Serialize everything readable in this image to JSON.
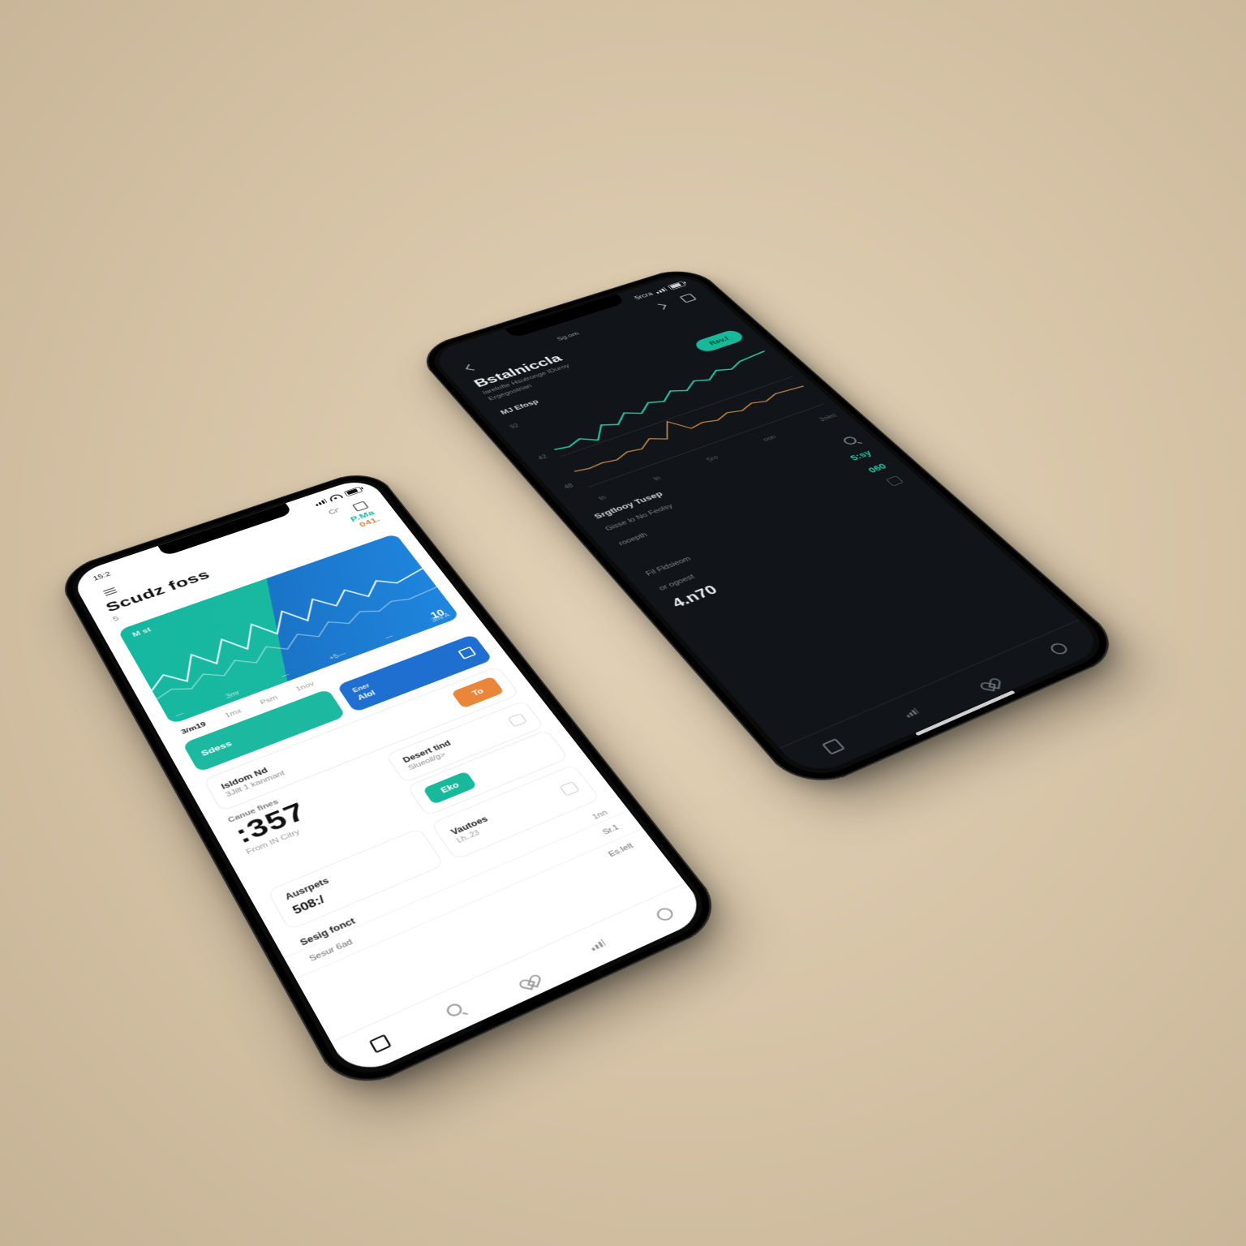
{
  "phone_light": {
    "statusbar": {
      "time": "15:2"
    },
    "header": {
      "title": "Scudz foss",
      "sub": "5"
    },
    "accent": {
      "line1": "P.Ma",
      "line2": "041."
    },
    "hero": {
      "tl": "M st",
      "br": "10",
      "xlabels": [
        "—",
        "3mr",
        "—",
        "+5—",
        "—",
        "3ml A"
      ]
    },
    "tabs": [
      "3/m19",
      "1mx",
      "Psm",
      "1nov"
    ],
    "pills": {
      "left": "Sdess",
      "right_top": "Ener",
      "right_bottom": "Alol"
    },
    "card1": {
      "title": "Isldom Nd",
      "sub": "3Jilt 1 kanmant",
      "button": "To"
    },
    "big": {
      "label": "Canue fines",
      "value": ":357",
      "sub": "From IN Citry"
    },
    "card2": {
      "title": "Desert tind",
      "sub": "Slueoil/g>",
      "button": "Eko"
    },
    "cols": [
      {
        "title": "Ausrpets",
        "sub": "",
        "value": "508:/"
      },
      {
        "title": "Vautoes",
        "sub": "Lh..23",
        "value": ""
      }
    ],
    "listhead": {
      "l": "Sesig fonct",
      "r": "1nn"
    },
    "rows": [
      {
        "l": "Sesur 6ad",
        "r": "Sr.1"
      },
      {
        "l": "",
        "r": "Es.Ielt"
      }
    ]
  },
  "phone_dark": {
    "statusbar": {
      "time": "",
      "right": "5rcra"
    },
    "top_badge": "Sg.om",
    "title": "Bstalniccla",
    "sub1": "larelofte Hsutronge lDuroy",
    "sub2": "Ergegostrian",
    "section": "MJ Efosp",
    "pill": "Rev.f",
    "chart_ylabels": [
      "92",
      "42",
      "48"
    ],
    "chart_xlabels": [
      "tn",
      "tn",
      "5ro",
      "oon",
      "3oles"
    ],
    "sect2": "Srgtlooy Tusep",
    "rows2": [
      {
        "l": "Gisse lo No Feolsy",
        "r": ""
      },
      {
        "l": "rooepth",
        "r": "5:sy"
      },
      {
        "l": "",
        "r": "060"
      },
      {
        "l": "Fil Fldsieom",
        "r": ""
      },
      {
        "l": "or ogoest",
        "r": ""
      }
    ],
    "big": "4.n70"
  },
  "colors": {
    "teal": "#18b89d",
    "blue": "#1f6fd1",
    "orange": "#e9863a",
    "chart_teal": "#24c7ab",
    "chart_amber": "#c98a4a"
  },
  "chart_data": [
    {
      "type": "line",
      "location": "phone_light.hero",
      "title": "M st",
      "series": [
        {
          "name": "main",
          "color": "#ffffff",
          "values": [
            42,
            55,
            40,
            70,
            48,
            78,
            52,
            84,
            60,
            88,
            64,
            90,
            70,
            86,
            74,
            82,
            78,
            80
          ]
        }
      ],
      "x": [
        "—",
        "3mr",
        "—",
        "+5—",
        "—",
        "3ml A"
      ],
      "ylim": [
        0,
        100
      ],
      "annotation_right": "10"
    },
    {
      "type": "line",
      "location": "phone_dark.chart",
      "series": [
        {
          "name": "teal",
          "color": "#24c7ab",
          "values": [
            60,
            58,
            62,
            55,
            68,
            63,
            72,
            66,
            74,
            70,
            78,
            73,
            80,
            76,
            83,
            79,
            84,
            86
          ]
        },
        {
          "name": "amber",
          "color": "#c98a4a",
          "values": [
            44,
            42,
            43,
            41,
            45,
            43,
            50,
            44,
            60,
            46,
            48,
            45,
            49,
            46,
            50,
            47,
            51,
            49
          ]
        }
      ],
      "x": [
        "tn",
        "tn",
        "5ro",
        "oon",
        "3oles"
      ],
      "yticks": [
        92,
        42,
        48
      ],
      "ylim": [
        30,
        100
      ]
    }
  ]
}
